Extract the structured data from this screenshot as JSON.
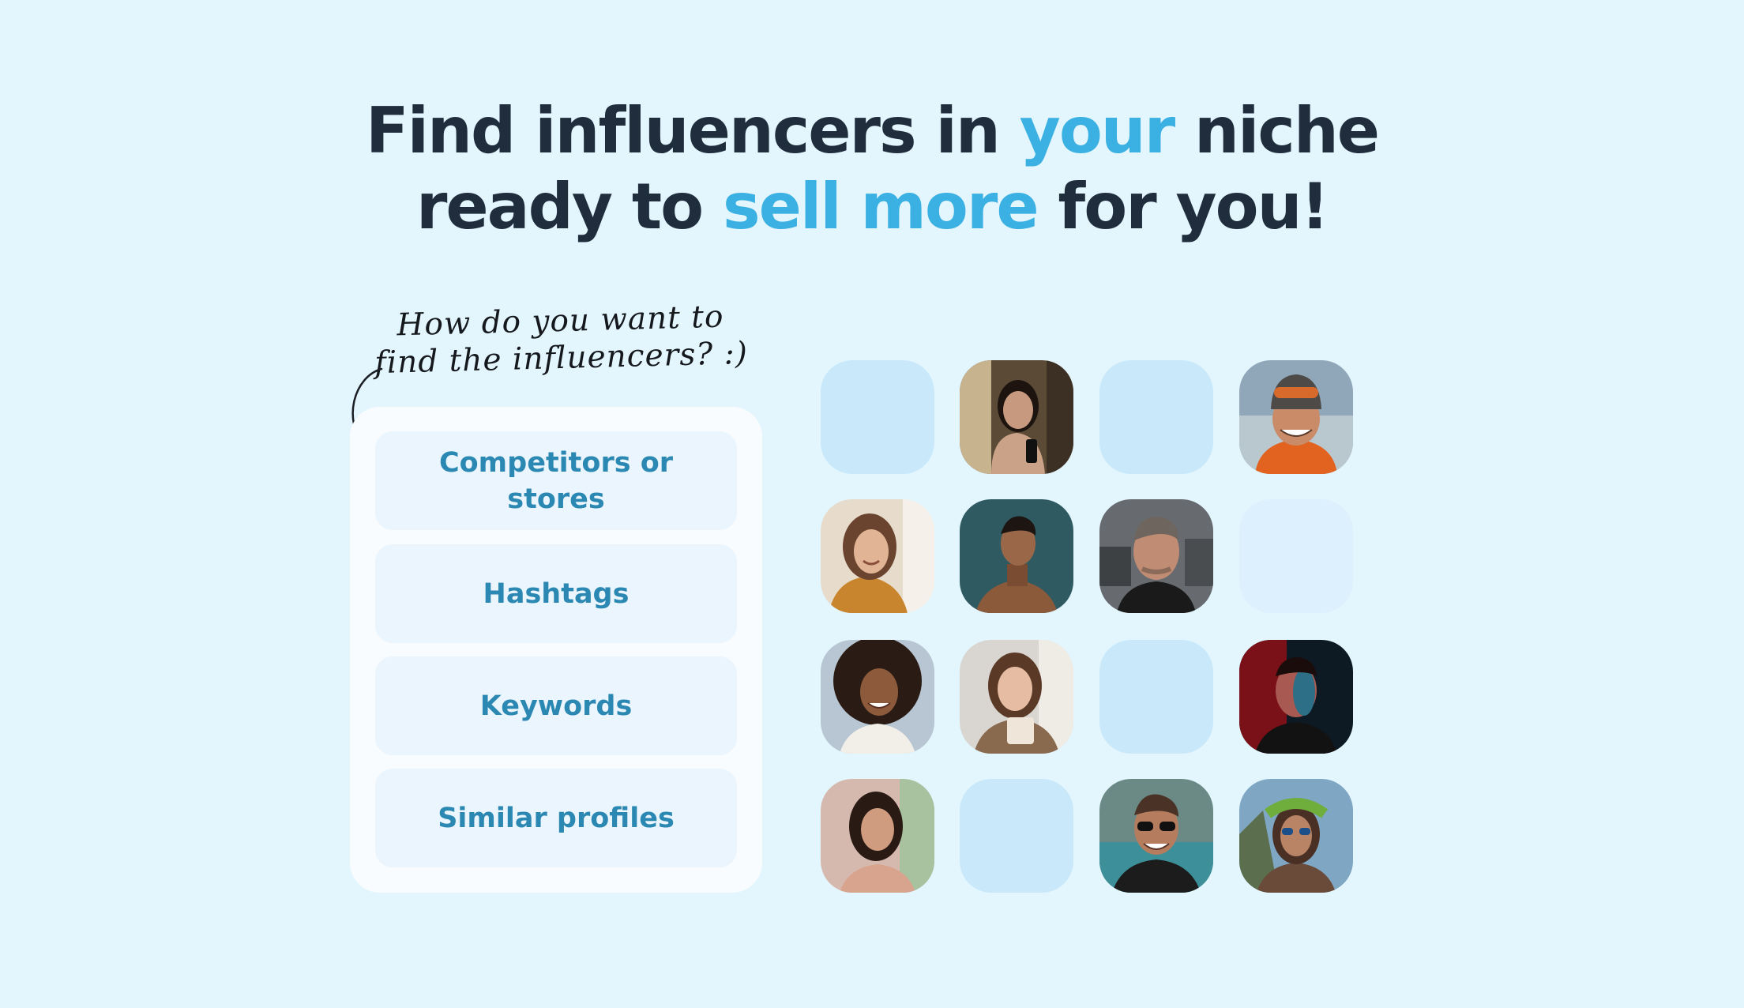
{
  "headline": {
    "line1_part1": "Find influencers in ",
    "line1_accent": "your",
    "line1_part2": " niche",
    "line2_part1": "ready to ",
    "line2_accent": "sell more",
    "line2_part2": " for you!"
  },
  "handnote": {
    "line1": "How do you want to",
    "line2": "find the influencers? :)"
  },
  "methods": [
    {
      "label": "Competitors or stores"
    },
    {
      "label": "Hashtags"
    },
    {
      "label": "Keywords"
    },
    {
      "label": "Similar profiles"
    }
  ],
  "colors": {
    "background": "#e3f6fe",
    "headline": "#1f2d3d",
    "accent": "#3bb0e2",
    "option_text": "#2b88b3",
    "option_background": "#eaf5fd",
    "panel_background": "#f9fcff",
    "tile_blank": "#c9e9fb"
  },
  "grid": {
    "row1": [
      "blank-tile",
      "woman-selfie-avatar",
      "blank-tile",
      "man-beanie-avatar"
    ],
    "row2": [
      "woman-smiling-avatar",
      "man-sky-avatar",
      "man-gym-avatar",
      "faint-tile"
    ],
    "row3": [
      "woman-curly-hair-avatar",
      "woman-drink-avatar",
      "blank-tile",
      "man-red-light-avatar"
    ],
    "row4": [
      "woman-street-avatar",
      "blank-tile",
      "man-sunglasses-avatar",
      "woman-flower-crown-avatar"
    ]
  }
}
